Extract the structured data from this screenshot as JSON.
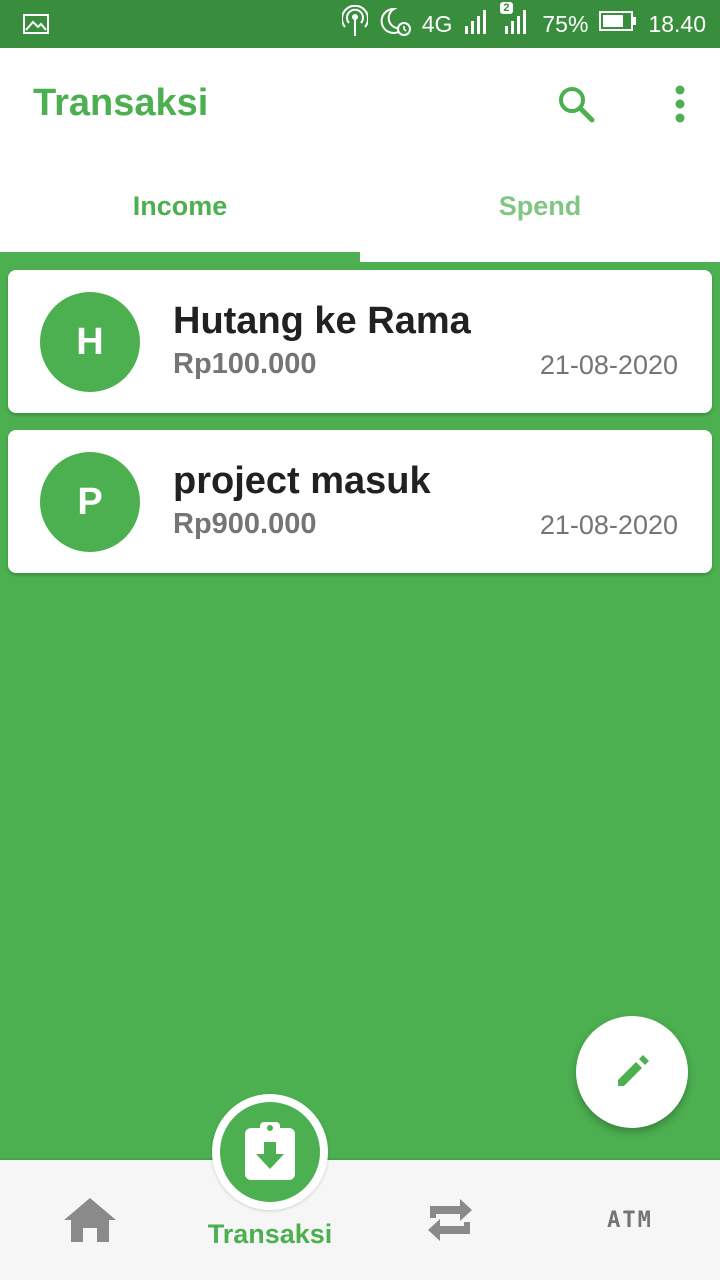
{
  "status_bar": {
    "network": "4G",
    "sim2_badge": "2",
    "battery": "75%",
    "time": "18.40"
  },
  "app_bar": {
    "title": "Transaksi"
  },
  "tabs": [
    {
      "label": "Income",
      "selected": true
    },
    {
      "label": "Spend",
      "selected": false
    }
  ],
  "transactions": [
    {
      "initial": "H",
      "title": "Hutang ke Rama",
      "amount": "Rp100.000",
      "date": "21-08-2020"
    },
    {
      "initial": "P",
      "title": "project masuk",
      "amount": "Rp900.000",
      "date": "21-08-2020"
    }
  ],
  "bottom_nav": {
    "home_icon": "home-icon",
    "transaksi_label": "Transaksi",
    "swap_icon": "swap-icon",
    "atm_label": "ATM"
  },
  "colors": {
    "primary": "#4caf50",
    "status_bar": "#388e3c"
  }
}
